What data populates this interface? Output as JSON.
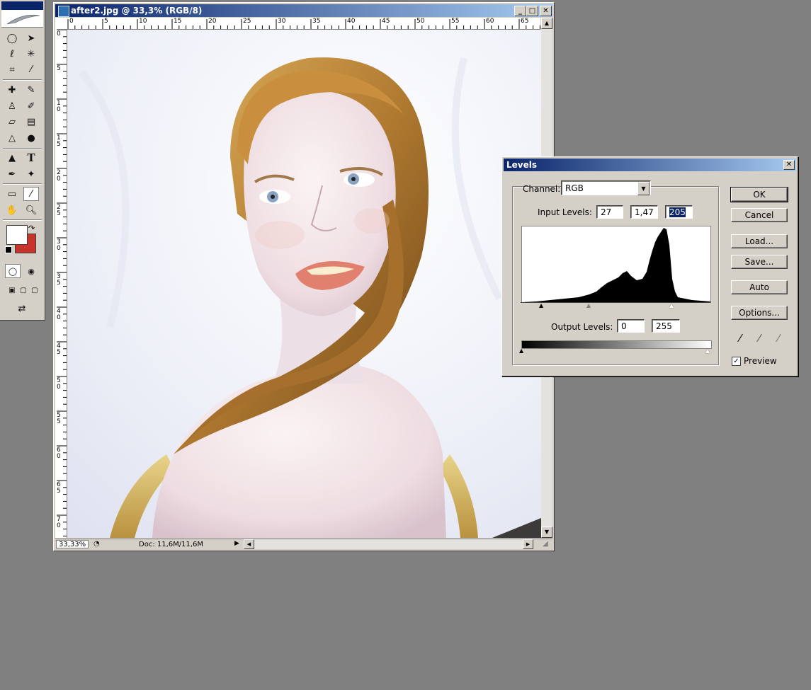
{
  "document": {
    "title": "after2.jpg @ 33,3% (RGB/8)",
    "ruler_top": [
      "0",
      "5",
      "10",
      "15",
      "20",
      "25",
      "30",
      "35",
      "40",
      "45",
      "50",
      "55",
      "60",
      "65"
    ],
    "ruler_left": [
      "0",
      "5",
      "1 0",
      "1 5",
      "2 0",
      "2 5",
      "3 0",
      "3 5",
      "4 0",
      "4 5",
      "5 0",
      "5 5",
      "6 0",
      "6 5",
      "7 0"
    ],
    "status": {
      "zoom": "33,33%",
      "doc": "Doc: 11,6M/11,6M"
    }
  },
  "levels": {
    "title": "Levels",
    "channel_label": "Channel:",
    "channel_value": "RGB",
    "input_label": "Input Levels:",
    "input_values": [
      "27",
      "1,47",
      "205"
    ],
    "output_label": "Output Levels:",
    "output_values": [
      "0",
      "255"
    ],
    "buttons": {
      "ok": "OK",
      "cancel": "Cancel",
      "load": "Load...",
      "save": "Save...",
      "auto": "Auto",
      "options": "Options..."
    },
    "preview_label": "Preview",
    "preview_checked": true
  },
  "toolbox": {
    "tools": [
      "marquee-tool",
      "move-tool",
      "lasso-tool",
      "magic-wand-tool",
      "crop-tool",
      "slice-tool",
      "healing-brush-tool",
      "brush-tool",
      "clone-stamp-tool",
      "history-brush-tool",
      "eraser-tool",
      "gradient-tool",
      "blur-tool",
      "dodge-tool",
      "path-selection-tool",
      "type-tool",
      "pen-tool",
      "custom-shape-tool",
      "notes-tool",
      "eyedropper-tool",
      "hand-tool",
      "zoom-tool"
    ],
    "foreground_color": "#ffffff",
    "background_color": "#c8332b"
  }
}
